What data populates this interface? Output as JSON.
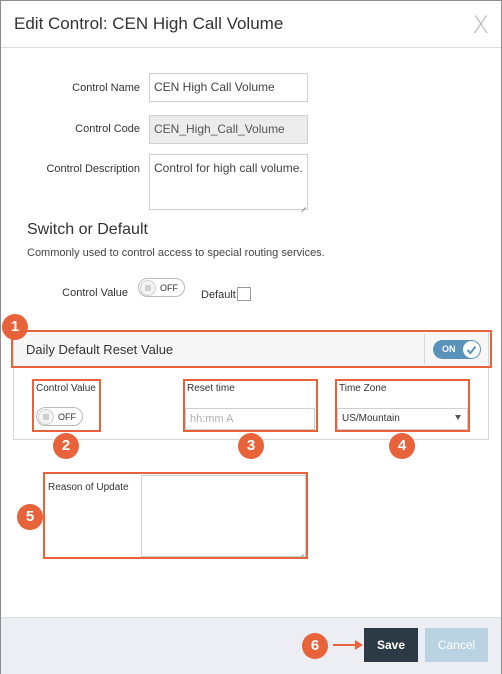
{
  "dialog": {
    "title": "Edit Control: CEN High Call Volume",
    "close_glyph": "X"
  },
  "form": {
    "control_name_label": "Control Name",
    "control_name_value": "CEN High Call Volume",
    "control_code_label": "Control Code",
    "control_code_value": "CEN_High_Call_Volume",
    "control_description_label": "Control Description",
    "control_description_value": "Control for high call volume."
  },
  "switch_section": {
    "title": "Switch or Default",
    "subtitle": "Commonly used to control access to special routing services.",
    "control_value_label": "Control Value",
    "control_value_state": "OFF",
    "default_label": "Default"
  },
  "daily_reset": {
    "title": "Daily Default Reset Value",
    "toggle_state": "ON",
    "control_value_label": "Control Value",
    "control_value_state": "OFF",
    "reset_time_label": "Reset time",
    "reset_time_placeholder": "hh:mm A",
    "time_zone_label": "Time Zone",
    "time_zone_selected": "US/Mountain"
  },
  "reason": {
    "label": "Reason of Update",
    "value": ""
  },
  "footer": {
    "save_label": "Save",
    "cancel_label": "Cancel"
  },
  "callouts": [
    "1",
    "2",
    "3",
    "4",
    "5",
    "6"
  ],
  "colors": {
    "callout": "#e8623a",
    "toggle_on": "#5a93b9",
    "save_button": "#2c3a45",
    "cancel_button_disabled": "#b9d3e2",
    "footer_bg": "#eceef3"
  },
  "icons": {
    "close": "close-icon",
    "toggle_knob": "grip-lines-icon",
    "on_check": "check-icon",
    "select_caret": "caret-down-icon",
    "arrow": "arrow-right-icon"
  }
}
